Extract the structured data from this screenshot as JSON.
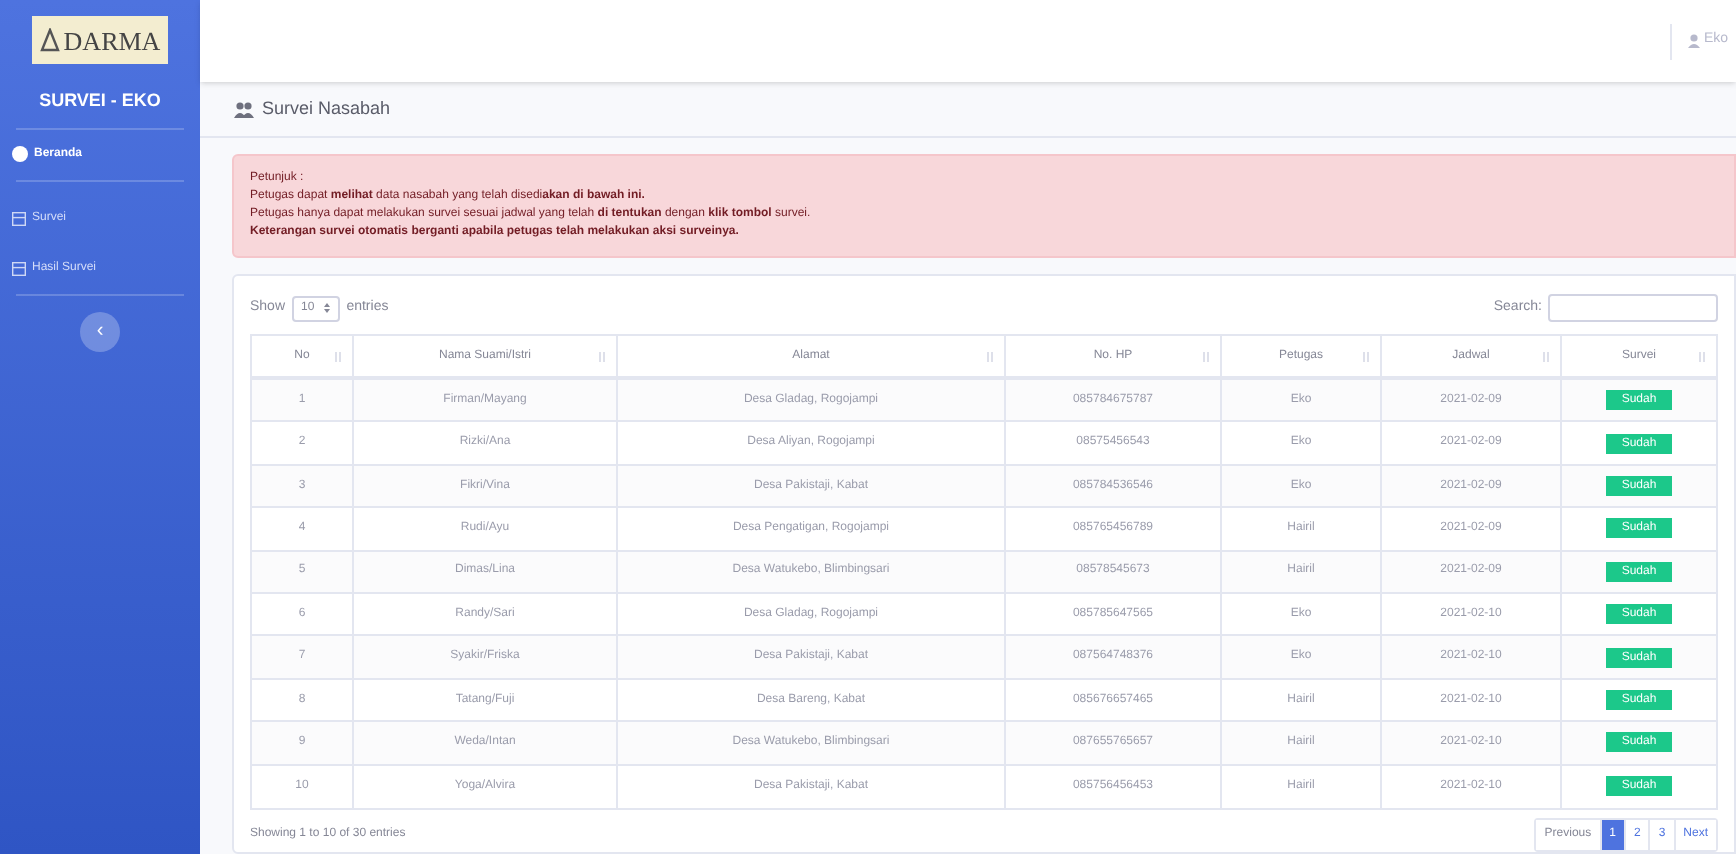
{
  "sidebar": {
    "logo_text": "DARMA",
    "title": "SURVEI - EKO",
    "items": [
      {
        "label": "Beranda",
        "selected": true,
        "kind": "home"
      },
      {
        "label": "Survei",
        "selected": false,
        "kind": "table"
      },
      {
        "label": "Hasil Survei",
        "selected": false,
        "kind": "table"
      }
    ],
    "toggle": "‹"
  },
  "topbar": {
    "user": "Eko"
  },
  "page_title": "Survei Nasabah",
  "alert": {
    "title": "Petunjuk :",
    "lines": [
      "Petugas dapat **melihat** data nasabah yang telah disedi**akan di bawah ini.**",
      "Petugas hanya dapat melakukan survei sesuai jadwal yang telah **di tentukan** dengan **klik tombol** survei.",
      "**Keterangan survei otomatis berganti apabila petugas telah melakukan aksi surveinya.**"
    ]
  },
  "table_controls": {
    "show_label": "Show",
    "page_size": "10",
    "entries_label": "entries",
    "search_label": "Search:"
  },
  "table": {
    "columns": [
      "No",
      "Nama Suami/Istri",
      "Alamat",
      "No. HP",
      "Petugas",
      "Jadwal",
      "Survei"
    ],
    "rows": [
      [
        "1",
        "Firman/Mayang",
        "Desa Gladag, Rogojampi",
        "085784675787",
        "Eko",
        "2021-02-09",
        "Sudah"
      ],
      [
        "2",
        "Rizki/Ana",
        "Desa Aliyan, Rogojampi",
        "08575456543",
        "Eko",
        "2021-02-09",
        "Sudah"
      ],
      [
        "3",
        "Fikri/Vina",
        "Desa Pakistaji, Kabat",
        "085784536546",
        "Eko",
        "2021-02-09",
        "Sudah"
      ],
      [
        "4",
        "Rudi/Ayu",
        "Desa Pengatigan, Rogojampi",
        "085765456789",
        "Hairil",
        "2021-02-09",
        "Sudah"
      ],
      [
        "5",
        "Dimas/Lina",
        "Desa Watukebo, Blimbingsari",
        "08578545673",
        "Hairil",
        "2021-02-09",
        "Sudah"
      ],
      [
        "6",
        "Randy/Sari",
        "Desa Gladag, Rogojampi",
        "085785647565",
        "Eko",
        "2021-02-10",
        "Sudah"
      ],
      [
        "7",
        "Syakir/Friska",
        "Desa Pakistaji, Kabat",
        "087564748376",
        "Eko",
        "2021-02-10",
        "Sudah"
      ],
      [
        "8",
        "Tatang/Fuji",
        "Desa Bareng, Kabat",
        "085676657465",
        "Hairil",
        "2021-02-10",
        "Sudah"
      ],
      [
        "9",
        "Weda/Intan",
        "Desa Watukebo, Blimbingsari",
        "087655765657",
        "Hairil",
        "2021-02-10",
        "Sudah"
      ],
      [
        "10",
        "Yoga/Alvira",
        "Desa Pakistaji, Kabat",
        "085756456453",
        "Hairil",
        "2021-02-10",
        "Sudah"
      ]
    ]
  },
  "info": "Showing 1 to 10 of 30 entries",
  "pagination": [
    {
      "label": "Previous",
      "selected": false
    },
    {
      "label": "1",
      "selected": true
    },
    {
      "label": "2",
      "selected": false
    },
    {
      "label": "3",
      "selected": false
    },
    {
      "label": "Next",
      "selected": false
    }
  ]
}
